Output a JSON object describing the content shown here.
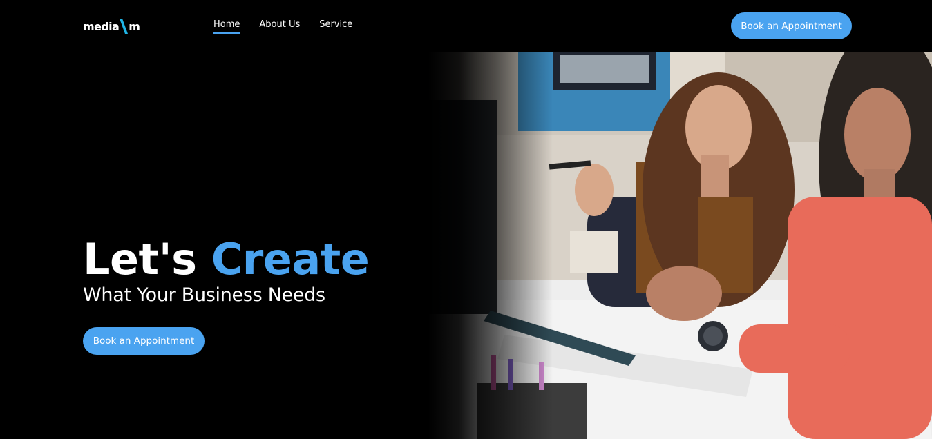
{
  "brand": {
    "logo_left": "media",
    "logo_right": "m",
    "accent_color": "#4aa3f0"
  },
  "nav": {
    "items": [
      {
        "label": "Home",
        "active": true
      },
      {
        "label": "About Us",
        "active": false
      },
      {
        "label": "Service",
        "active": false
      }
    ]
  },
  "header": {
    "cta_label": "Book an Appointment"
  },
  "hero": {
    "title_plain": "Let's",
    "title_accent": "Create",
    "subtitle": "What Your Business Needs",
    "cta_label": "Book an Appointment",
    "image_icon": "photo-of-two-women-at-computer"
  }
}
